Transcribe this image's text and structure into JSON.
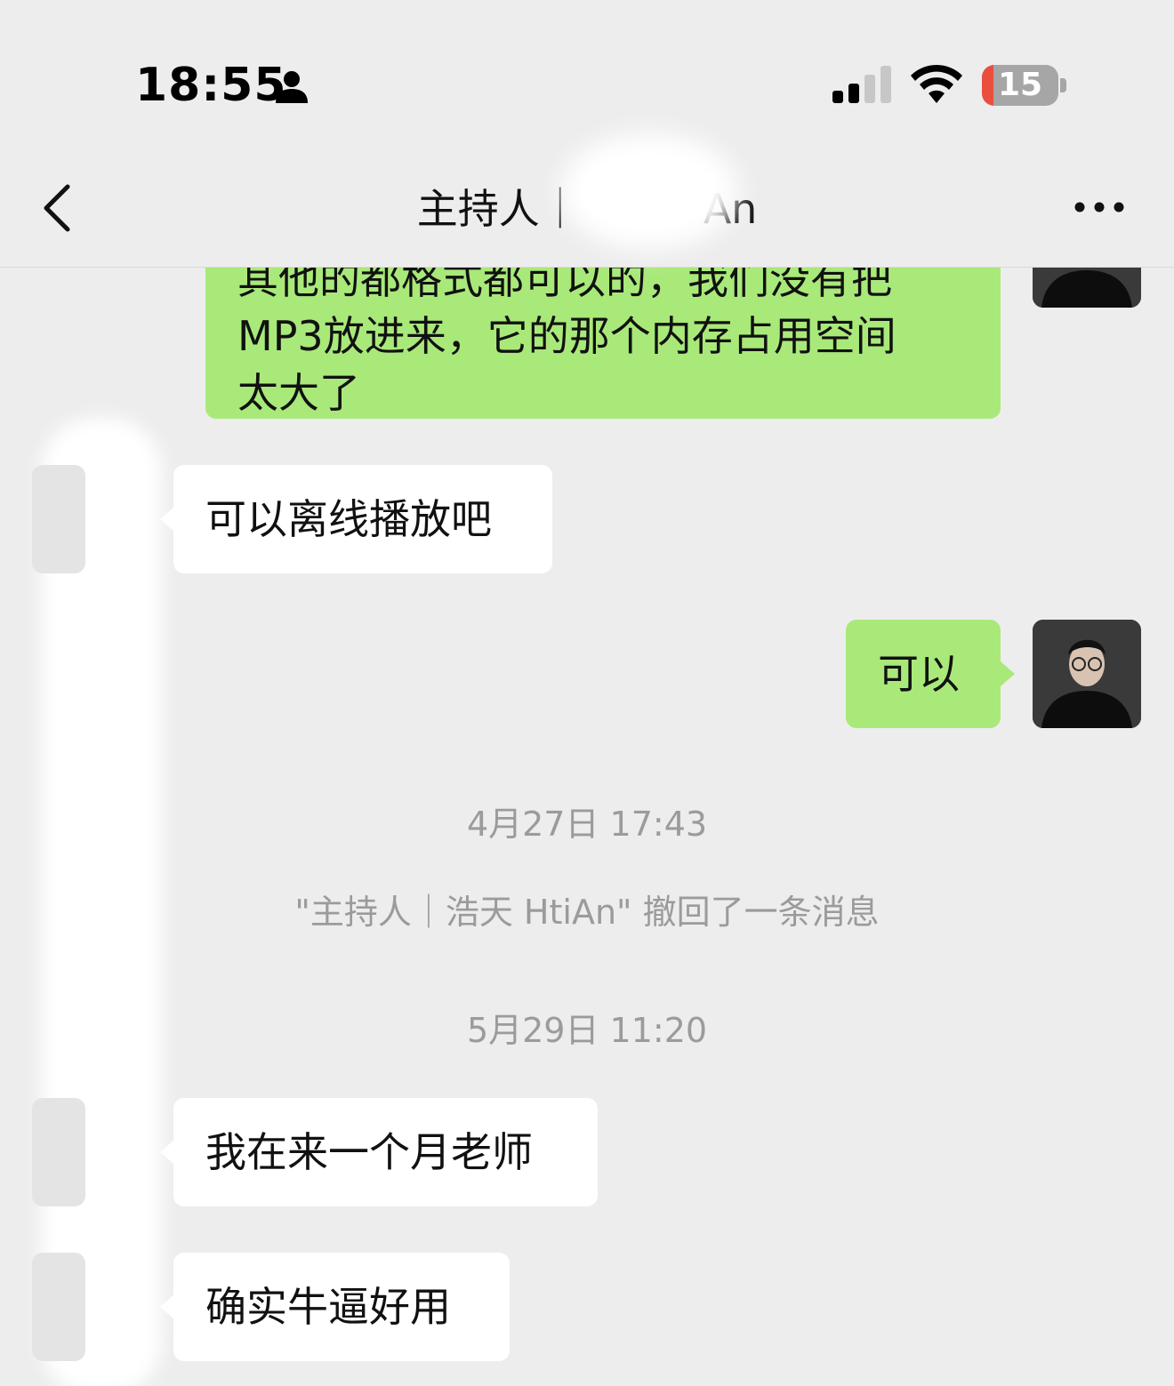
{
  "status_bar": {
    "time": "18:55",
    "battery_percent": "15",
    "battery_level": 0.15,
    "icons": [
      "person-icon",
      "signal-icon",
      "wifi-icon",
      "battery-icon"
    ]
  },
  "nav": {
    "title": "主持人｜　　　An",
    "back_icon": "chevron-left-icon",
    "more_icon": "more-dots-icon"
  },
  "messages": [
    {
      "direction": "out",
      "lines": [
        "其他的都格式都可以的，我们没有把",
        "MP3放进来，它的那个内存占用空间",
        "太大了"
      ]
    },
    {
      "direction": "in",
      "text": "可以离线播放吧"
    },
    {
      "direction": "out",
      "text": "可以"
    },
    {
      "type": "timestamp",
      "text": "4月27日 17:43"
    },
    {
      "type": "system",
      "text": "\"主持人｜浩天 HtiAn\" 撤回了一条消息"
    },
    {
      "type": "timestamp",
      "text": "5月29日 11:20"
    },
    {
      "direction": "in",
      "text": "我在来一个月老师"
    },
    {
      "direction": "in",
      "text": "确实牛逼好用"
    }
  ],
  "colors": {
    "background": "#ededed",
    "outgoing_bubble": "#a9e97a",
    "incoming_bubble": "#ffffff",
    "timestamp_text": "#9b9b9b",
    "battery_low": "#ea4f3d"
  }
}
